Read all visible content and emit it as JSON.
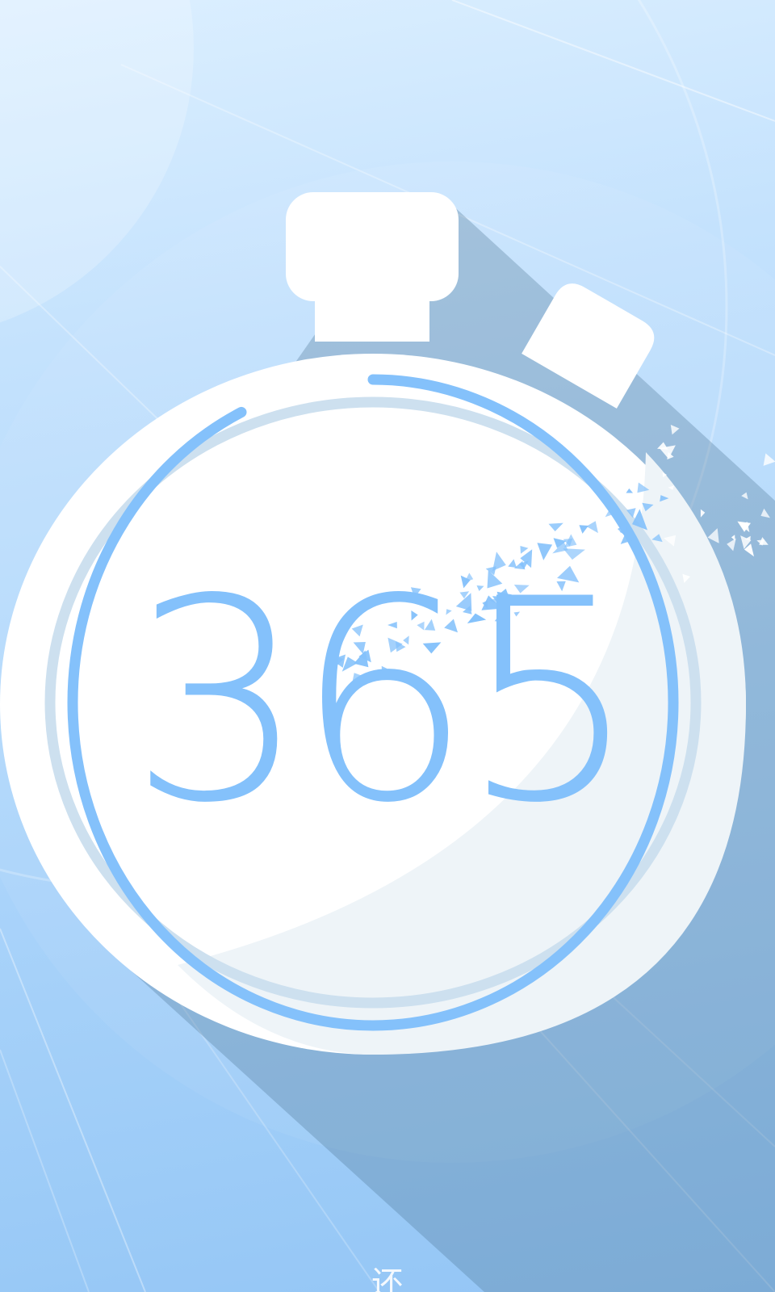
{
  "splash": {
    "app_number": "365",
    "caption": "还"
  },
  "stopwatch": {
    "progress_fraction": 0.93
  },
  "colors": {
    "background_top": "#dcefff",
    "background_bottom": "#93c5f5",
    "accent_blue": "#84c1fb",
    "progress_track": "#cde0ef",
    "long_shadow": "#7ea2bf",
    "watch_face": "#ffffff",
    "watch_face_shade": "#eef4f8"
  },
  "icons": {
    "watch": "stopwatch-icon",
    "crown": "stopwatch-crown-icon",
    "side_button": "stopwatch-side-button-icon",
    "shatter": "shatter-particles"
  }
}
